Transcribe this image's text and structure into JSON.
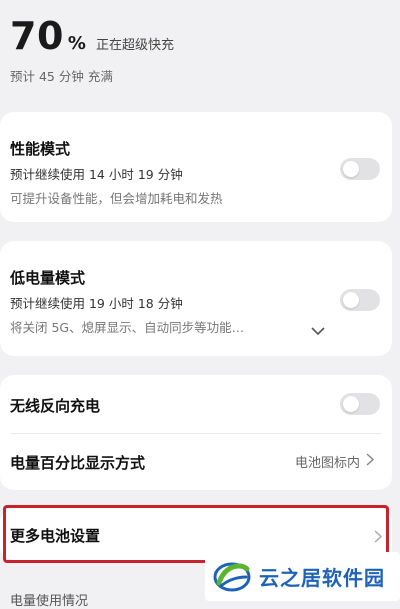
{
  "header": {
    "percent": "70",
    "percent_sign": "%",
    "charge_status": "正在超级快充",
    "eta": "预计 45 分钟 充满"
  },
  "performance_mode": {
    "title": "性能模式",
    "estimate": "预计继续使用 14 小时 19 分钟",
    "description": "可提升设备性能，但会增加耗电和发热",
    "enabled": false
  },
  "low_power_mode": {
    "title": "低电量模式",
    "estimate": "预计继续使用 19 小时 18 分钟",
    "description": "将关闭 5G、熄屏显示、自动同步等功能…",
    "enabled": false
  },
  "wireless_reverse": {
    "title": "无线反向充电",
    "enabled": false
  },
  "percentage_display": {
    "title": "电量百分比显示方式",
    "value": "电池图标内"
  },
  "more_settings": {
    "title": "更多电池设置"
  },
  "usage_section": {
    "label": "电量使用情况"
  },
  "watermark": {
    "text": "云之居软件园"
  },
  "colors": {
    "background": "#f1f1f3",
    "card": "#ffffff",
    "highlight": "#c8232c",
    "watermark_blue": "#1e63b8",
    "watermark_green": "#5bb531"
  }
}
